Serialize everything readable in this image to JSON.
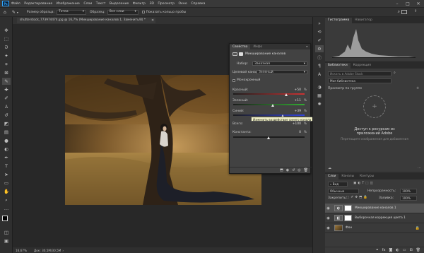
{
  "app": {
    "logo": "Ps"
  },
  "menu": [
    "Файл",
    "Редактирование",
    "Изображение",
    "Слои",
    "Текст",
    "Выделение",
    "Фильтр",
    "3D",
    "Просмотр",
    "Окно",
    "Справка"
  ],
  "window_controls": [
    "–",
    "□",
    "✕"
  ],
  "options_bar": {
    "sample_size_label": "Размер образца:",
    "sample_size_value": "Точка",
    "sample_label": "Образец:",
    "sample_value": "Все слои",
    "show_ring_label": "Показать кольцо пробы"
  },
  "document": {
    "tab_title": "shutterstock_773974474.jpg @ 16,7% (Микширование каналов 1, Заменить/8) *",
    "close": "✕"
  },
  "status": {
    "zoom": "16,67%",
    "doc_size": "Док: 30,5M/30,5M"
  },
  "properties": {
    "tabs": [
      "Свойства",
      "Инфо"
    ],
    "header": "Микширование каналов",
    "preset_label": "Набор:",
    "preset_value": "Заказная",
    "output_channel_label": "Целевой канал:",
    "output_channel_value": "Зеленый",
    "monochrome_label": "Монохромный",
    "sliders": [
      {
        "label": "Красный:",
        "value": "+50",
        "unit": "%",
        "level": 0.75,
        "color": "#cc3333"
      },
      {
        "label": "Зеленый:",
        "value": "+11",
        "unit": "%",
        "level": 0.555,
        "color": "#33aa33"
      },
      {
        "label": "Синий:",
        "value": "+39",
        "unit": "%",
        "level": 0.695,
        "color": "#3344dd"
      }
    ],
    "total_label": "Всего:",
    "total_value": "+100",
    "total_unit": "%",
    "constant_label": "Константа:",
    "constant_value": "0",
    "constant_unit": "%",
    "constant_level": 0.5,
    "tooltip": "Изменить воздействие синего канала на общий результат смешения"
  },
  "histogram_panel": {
    "tabs": [
      "Гистограмма",
      "Навигатор"
    ]
  },
  "libraries_panel": {
    "tabs": [
      "Библиотеки",
      "Коррекция"
    ],
    "search_placeholder": "Искать в Adobe Stock",
    "library_name": "Моя библиотека",
    "view_label": "Просмотр по группе",
    "promo_title": "Доступ к ресурсам из приложений Adobe",
    "promo_body": "Перетащите изображения для добавления",
    "size_label": "—"
  },
  "layers_panel": {
    "tabs": [
      "Слои",
      "Каналы",
      "Контуры"
    ],
    "kind_label": "Вид",
    "blend_mode": "Обычные",
    "opacity_label": "Непрозрачность:",
    "opacity_value": "100%",
    "lock_label": "Закрепить:",
    "fill_label": "Заливка:",
    "fill_value": "100%",
    "layers": [
      {
        "name": "Микширование каналов 1",
        "type": "adjustment"
      },
      {
        "name": "Выборочная коррекция цвета 1",
        "type": "adjustment"
      },
      {
        "name": "Фон",
        "type": "image"
      }
    ]
  }
}
